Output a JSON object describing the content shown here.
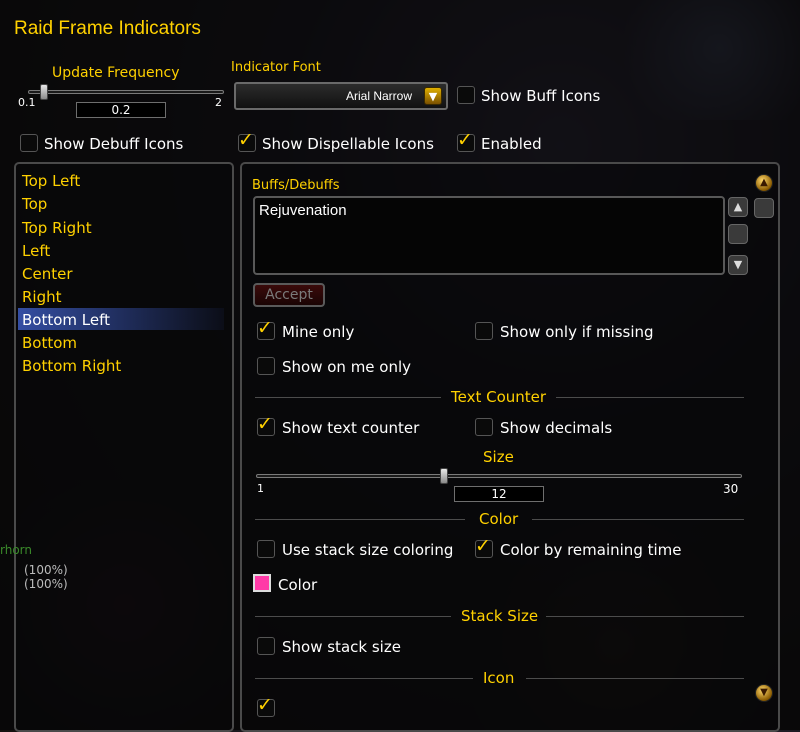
{
  "window": {
    "title": "Raid Frame Indicators"
  },
  "update_frequency": {
    "label": "Update Frequency",
    "min": "0.1",
    "max": "2",
    "value": "0.2",
    "fraction": 0.05
  },
  "indicator_font": {
    "label": "Indicator Font",
    "selected": "Arial Narrow"
  },
  "top_options": {
    "show_buff_icons": {
      "label": "Show Buff Icons",
      "checked": false
    },
    "show_debuff_icons": {
      "label": "Show Debuff Icons",
      "checked": false
    },
    "show_dispellable_icons": {
      "label": "Show Dispellable Icons",
      "checked": true
    },
    "enabled": {
      "label": "Enabled",
      "checked": true
    }
  },
  "positions": {
    "items": [
      "Top Left",
      "Top",
      "Top Right",
      "Left",
      "Center",
      "Right",
      "Bottom Left",
      "Bottom",
      "Bottom Right"
    ],
    "selected": "Bottom Left"
  },
  "buffs": {
    "label": "Buffs/Debuffs",
    "text": "Rejuvenation",
    "accept_label": "Accept"
  },
  "options": {
    "mine_only": {
      "label": "Mine only",
      "checked": true
    },
    "show_only_if_missing": {
      "label": "Show only if missing",
      "checked": false
    },
    "show_on_me_only": {
      "label": "Show on me only",
      "checked": false
    }
  },
  "text_counter": {
    "header": "Text Counter",
    "show_text_counter": {
      "label": "Show text counter",
      "checked": true
    },
    "show_decimals": {
      "label": "Show decimals",
      "checked": false
    },
    "size_label": "Size",
    "size_min": "1",
    "size_max": "30",
    "size_value": "12",
    "size_fraction": 0.38
  },
  "color": {
    "header": "Color",
    "use_stack_size_coloring": {
      "label": "Use stack size coloring",
      "checked": false
    },
    "color_by_remaining_time": {
      "label": "Color by remaining time",
      "checked": true
    },
    "color_label": "Color",
    "swatch": "#ff3aa7"
  },
  "stack_size": {
    "header": "Stack Size",
    "show_stack_size": {
      "label": "Show stack size",
      "checked": false
    }
  },
  "icon": {
    "header": "Icon"
  },
  "background_text": {
    "hp1": "(100%)",
    "hp2": "(100%)",
    "name": "rhorn"
  },
  "colors": {
    "gold": "#ffd100",
    "selection": "#3c5abe",
    "swatch": "#ff3aa7"
  }
}
